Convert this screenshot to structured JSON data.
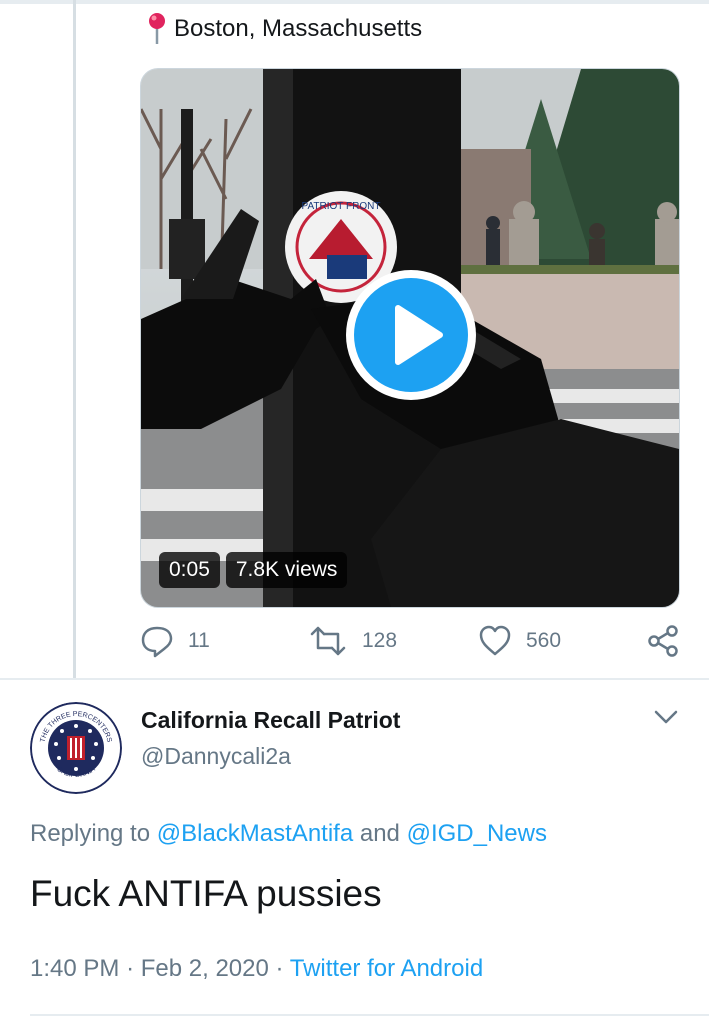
{
  "previous_tweet": {
    "location": "Boston, Massachusetts",
    "video": {
      "duration": "0:05",
      "views": "7.8K views",
      "sticker_text": "PATRIOT FRONT"
    },
    "actions": {
      "replies": "11",
      "retweets": "128",
      "likes": "560"
    }
  },
  "tweet": {
    "author": {
      "display_name": "California Recall Patriot",
      "handle": "@Dannycali2a",
      "avatar_text_top": "THE THREE PERCENTERS",
      "avatar_text_bottom": "CALIFORNIA"
    },
    "replying_prefix": "Replying to",
    "reply_to_1": "@BlackMastAntifa",
    "reply_conjunction": "and",
    "reply_to_2": "@IGD_News",
    "text": "Fuck ANTIFA pussies",
    "time": "1:40 PM",
    "date": "Feb 2, 2020",
    "separator": "·",
    "source": "Twitter for Android"
  },
  "colors": {
    "accent": "#1da1f2",
    "secondary_text": "#657786",
    "divider": "#e6ecf0"
  },
  "icons": [
    "map-pin-icon",
    "play-icon",
    "reply-icon",
    "retweet-icon",
    "like-icon",
    "share-icon",
    "chevron-down-icon"
  ]
}
